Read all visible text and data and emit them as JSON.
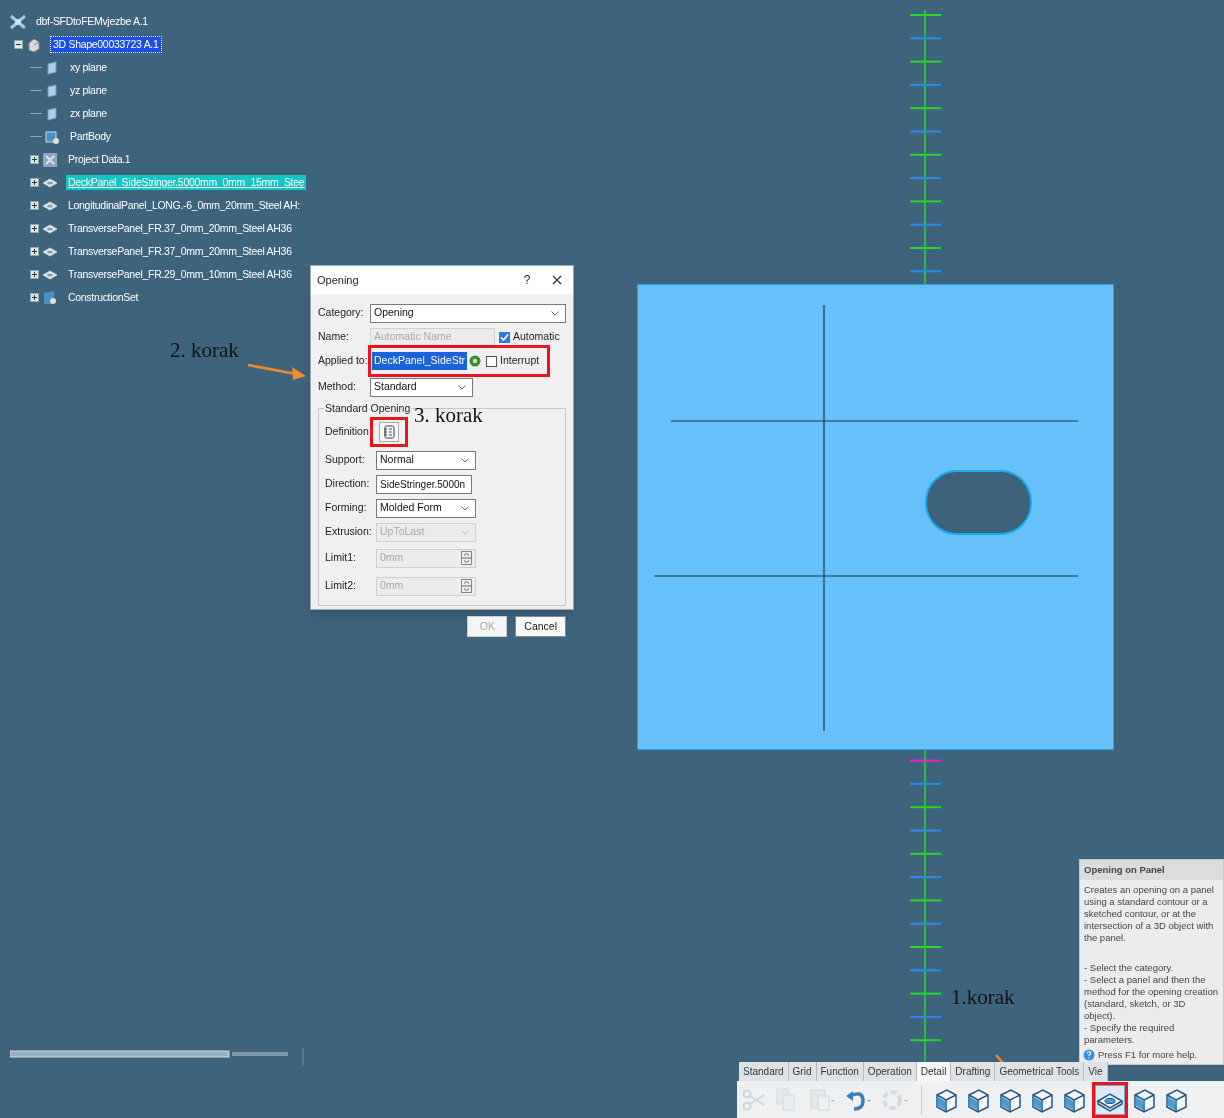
{
  "tree": {
    "label": "dbf-SFDtoFEMvjezbe A.1",
    "kind": "product",
    "selected": false,
    "highlighted": false,
    "children": [
      {
        "label": "3D Shape00033723 A.1",
        "kind": "part",
        "selected": true,
        "highlighted": false,
        "expanded": true,
        "children": [
          {
            "label": "xy plane",
            "kind": "plane",
            "selected": false,
            "highlighted": false
          },
          {
            "label": "yz plane",
            "kind": "plane",
            "selected": false,
            "highlighted": false
          },
          {
            "label": "zx plane",
            "kind": "plane",
            "selected": false,
            "highlighted": false
          },
          {
            "label": "PartBody",
            "kind": "body",
            "selected": false,
            "highlighted": false
          },
          {
            "label": "Project Data.1",
            "kind": "data",
            "selected": false,
            "highlighted": false,
            "expanded": false
          },
          {
            "label": "DeckPanel_SideStringer.5000mm_0mm_15mm_Stee",
            "kind": "panel",
            "selected": false,
            "highlighted": true,
            "expanded": false
          },
          {
            "label": "LongitudinalPanel_LONG.-6_0mm_20mm_Steel AH:",
            "kind": "panel",
            "selected": false,
            "highlighted": false,
            "expanded": false
          },
          {
            "label": "TransversePanel_FR.37_0mm_20mm_Steel AH36",
            "kind": "panel",
            "selected": false,
            "highlighted": false,
            "expanded": false
          },
          {
            "label": "TransversePanel_FR.37_0mm_20mm_Steel AH36",
            "kind": "panel",
            "selected": false,
            "highlighted": false,
            "expanded": false
          },
          {
            "label": "TransversePanel_FR.29_0mm_10mm_Steel AH36",
            "kind": "panel",
            "selected": false,
            "highlighted": false,
            "expanded": false
          },
          {
            "label": "ConstructionSet",
            "kind": "set",
            "selected": false,
            "highlighted": false,
            "expanded": false
          }
        ]
      }
    ]
  },
  "dialog": {
    "title": "Opening",
    "help": "?",
    "rows": [
      {
        "kind": "dropdown",
        "label": "Category:",
        "value": "Opening",
        "disabled": false
      },
      {
        "kind": "name",
        "label": "Name:",
        "value": "Automatic Name",
        "disabled": true,
        "checkbox": {
          "label": "Automatic",
          "checked": true
        }
      },
      {
        "kind": "applied",
        "label": "Applied to:",
        "value": "DeckPanel_SideStr",
        "disabled": false,
        "checkbox": {
          "label": "Interrupt",
          "checked": false
        }
      },
      {
        "kind": "dropdown",
        "label": "Method:",
        "value": "Standard",
        "disabled": false
      }
    ],
    "group": {
      "title": "Standard Opening",
      "rows": [
        {
          "kind": "definition",
          "label": "Definition",
          "disabled": false
        },
        {
          "kind": "dropdown",
          "label": "Support:",
          "value": "Normal",
          "disabled": false
        },
        {
          "kind": "text",
          "label": "Direction:",
          "value": "SideStringer.5000n",
          "disabled": false
        },
        {
          "kind": "dropdown",
          "label": "Forming:",
          "value": "Molded Form",
          "disabled": false
        },
        {
          "kind": "dropdown",
          "label": "Extrusion:",
          "value": "UpToLast",
          "disabled": true
        },
        {
          "kind": "spinner",
          "label": "Limit1:",
          "value": "0mm",
          "disabled": true
        },
        {
          "kind": "spinner",
          "label": "Limit2:",
          "value": "0mm",
          "disabled": true
        }
      ]
    },
    "buttons": [
      {
        "label": "OK",
        "disabled": true
      },
      {
        "label": "Cancel",
        "disabled": false
      }
    ]
  },
  "annotations": [
    "2. korak",
    "3. korak",
    "1.korak"
  ],
  "tooltip": {
    "title": "Opening on Panel",
    "paragraphs": [
      "Creates an opening on a panel using a standard contour or a sketched contour, or at the intersection of a 3D object with the panel.",
      "- Select the category.\n- Select a panel and then the method for the opening creation (standard, sketch, or 3D object).\n- Specify the required parameters."
    ],
    "help": "Press F1 for more help."
  },
  "toolbar": {
    "tabs": [
      {
        "label": "Standard",
        "selected": false
      },
      {
        "label": "Grid",
        "selected": false
      },
      {
        "label": "Function",
        "selected": false
      },
      {
        "label": "Operation",
        "selected": false
      },
      {
        "label": "Detail",
        "selected": true
      },
      {
        "label": "Drafting",
        "selected": false
      },
      {
        "label": "Geometrical Tools",
        "selected": false
      },
      {
        "label": "Vie",
        "selected": false
      }
    ],
    "tools": [
      {
        "kind": "cut",
        "disabled": true,
        "selected": false
      },
      {
        "kind": "copy",
        "disabled": true,
        "selected": false
      },
      {
        "kind": "paste",
        "disabled": true,
        "selected": false
      },
      {
        "kind": "undo",
        "disabled": false,
        "selected": false
      },
      {
        "kind": "refresh",
        "disabled": true,
        "selected": false
      },
      {
        "kind": "panel",
        "disabled": false,
        "selected": false
      },
      {
        "kind": "panel",
        "disabled": false,
        "selected": false
      },
      {
        "kind": "panel",
        "disabled": false,
        "selected": false
      },
      {
        "kind": "panel",
        "disabled": false,
        "selected": false
      },
      {
        "kind": "panel",
        "disabled": false,
        "selected": false
      },
      {
        "kind": "opening",
        "disabled": false,
        "selected": true
      },
      {
        "kind": "panel",
        "disabled": false,
        "selected": false
      },
      {
        "kind": "panel",
        "disabled": false,
        "selected": false
      }
    ]
  }
}
